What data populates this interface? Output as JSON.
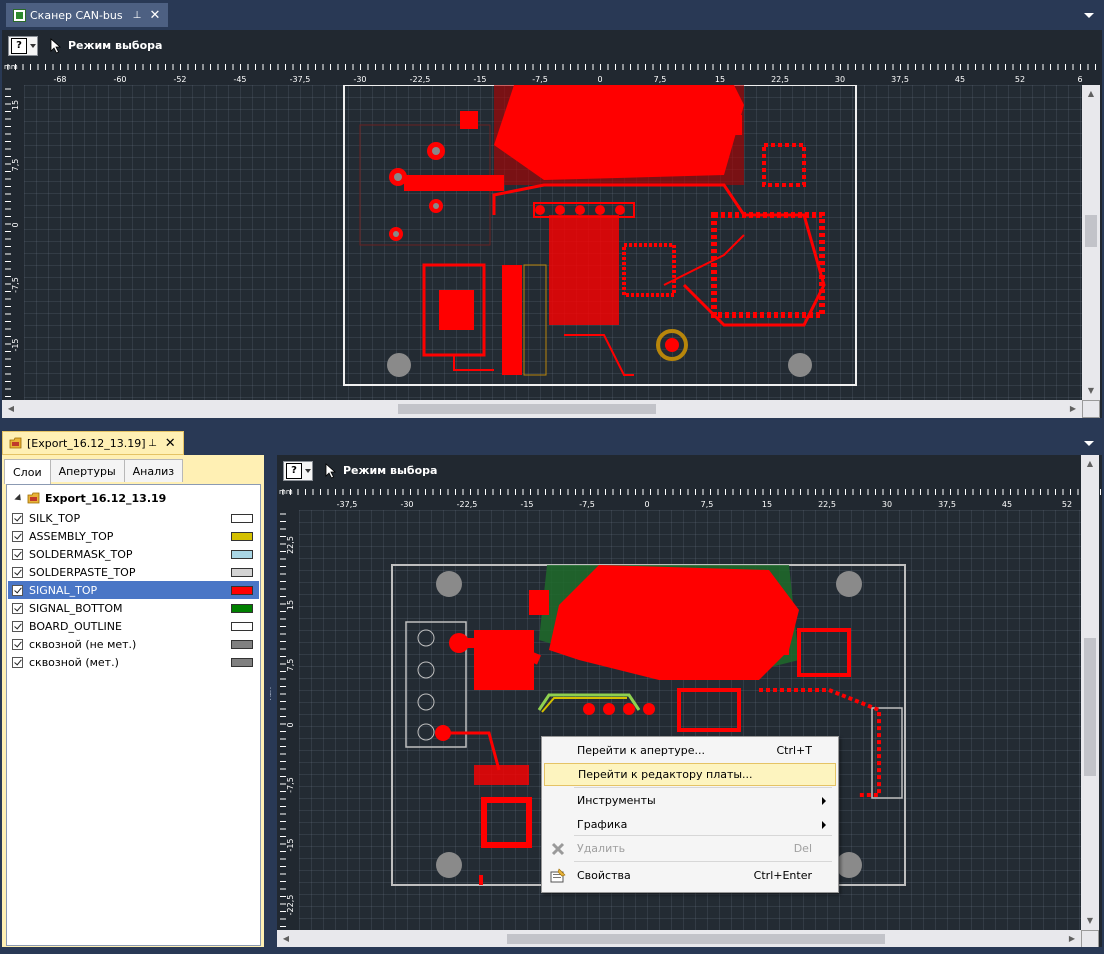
{
  "top_window": {
    "tab_label": "Сканер CAN-bus",
    "tab_icon": "scanner-doc-icon",
    "toolbar": {
      "help_label": "?",
      "mode_label": "Режим выбора"
    },
    "ruler": {
      "unit": "mm",
      "x_ticks": [
        "-68",
        "-60",
        "-52",
        "-45",
        "-37,5",
        "-30",
        "-22,5",
        "-15",
        "-7,5",
        "0",
        "7,5",
        "15",
        "22,5",
        "30",
        "37,5",
        "45",
        "52",
        "6"
      ],
      "y_ticks": [
        "15",
        "7,5",
        "0",
        "-7,5",
        "-15"
      ]
    }
  },
  "bottom_window": {
    "tab_label": "[Export_16.12_13.19]",
    "tab_icon": "export-folder-icon",
    "panel_tabs": [
      "Слои",
      "Апертуры",
      "Анализ"
    ],
    "tree_root": "Export_16.12_13.19",
    "layers": [
      {
        "name": "SILK_TOP",
        "color": "#ffffff"
      },
      {
        "name": "ASSEMBLY_TOP",
        "color": "#d4c000"
      },
      {
        "name": "SOLDERMASK_TOP",
        "color": "#a9d6e5"
      },
      {
        "name": "SOLDERPASTE_TOP",
        "color": "#d3d3d3"
      },
      {
        "name": "SIGNAL_TOP",
        "color": "#ff0000",
        "selected": true
      },
      {
        "name": "SIGNAL_BOTTOM",
        "color": "#008000"
      },
      {
        "name": "BOARD_OUTLINE",
        "color": "#ffffff"
      },
      {
        "name": "сквозной (не мет.)",
        "color": "#808080"
      },
      {
        "name": "сквозной (мет.)",
        "color": "#808080"
      }
    ],
    "toolbar": {
      "help_label": "?",
      "mode_label": "Режим выбора"
    },
    "ruler": {
      "unit": "mm",
      "x_ticks": [
        "-37,5",
        "-30",
        "-22,5",
        "-15",
        "-7,5",
        "0",
        "7,5",
        "15",
        "22,5",
        "30",
        "37,5",
        "45",
        "52"
      ],
      "y_ticks": [
        "22,5",
        "15",
        "7,5",
        "0",
        "-7,5",
        "-15",
        "-22,5"
      ]
    }
  },
  "context_menu": {
    "items": [
      {
        "label": "Перейти к апертуре...",
        "shortcut": "Ctrl+T"
      },
      {
        "label": "Перейти к редактору платы...",
        "shortcut": "",
        "highlighted": true
      },
      {
        "label": "Инструменты",
        "shortcut": "",
        "submenu": true
      },
      {
        "label": "Графика",
        "shortcut": "",
        "submenu": true
      },
      {
        "label": "Удалить",
        "shortcut": "Del",
        "disabled": true,
        "icon": "delete-x-icon"
      },
      {
        "label": "Свойства",
        "shortcut": "Ctrl+Enter",
        "icon": "properties-icon"
      }
    ]
  },
  "colors": {
    "copper_top": "#ff0000",
    "copper_bottom": "#1e6b2a",
    "board_bg": "#232b33",
    "accent": "#293955"
  }
}
